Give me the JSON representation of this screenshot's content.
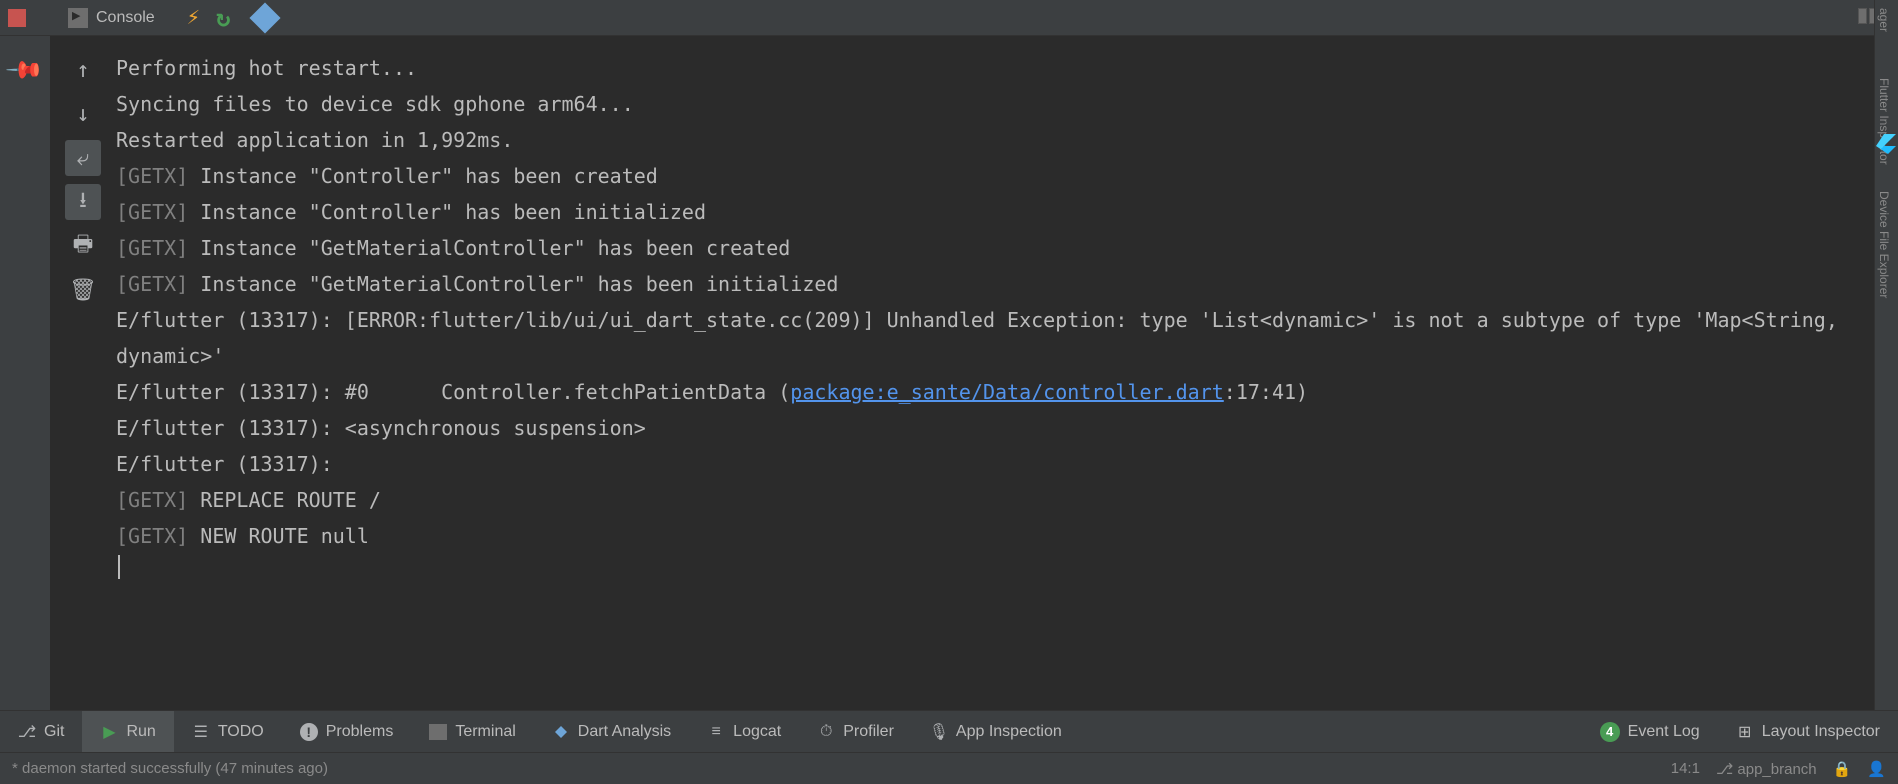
{
  "toolbar": {
    "console_label": "Console"
  },
  "console": {
    "lines": [
      {
        "type": "plain",
        "text": "Performing hot restart..."
      },
      {
        "type": "plain",
        "text": "Syncing files to device sdk gphone arm64..."
      },
      {
        "type": "plain",
        "text": "Restarted application in 1,992ms."
      },
      {
        "type": "tagged",
        "tag": "[GETX]",
        "text": " Instance \"Controller\" has been created"
      },
      {
        "type": "tagged",
        "tag": "[GETX]",
        "text": " Instance \"Controller\" has been initialized"
      },
      {
        "type": "tagged",
        "tag": "[GETX]",
        "text": " Instance \"GetMaterialController\" has been created"
      },
      {
        "type": "tagged",
        "tag": "[GETX]",
        "text": " Instance \"GetMaterialController\" has been initialized"
      },
      {
        "type": "plain",
        "text": "E/flutter (13317): [ERROR:flutter/lib/ui/ui_dart_state.cc(209)] Unhandled Exception: type 'List<dynamic>' is not a subtype of type 'Map<String, dynamic>'"
      },
      {
        "type": "link",
        "prefix": "E/flutter (13317): #0      Controller.fetchPatientData (",
        "link": "package:e_sante/Data/controller.dart",
        "suffix": ":17:41)"
      },
      {
        "type": "plain",
        "text": "E/flutter (13317): <asynchronous suspension>"
      },
      {
        "type": "plain",
        "text": "E/flutter (13317): "
      },
      {
        "type": "tagged",
        "tag": "[GETX]",
        "text": " REPLACE ROUTE /"
      },
      {
        "type": "tagged",
        "tag": "[GETX]",
        "text": " NEW ROUTE null"
      }
    ]
  },
  "bottom_tabs": {
    "git": "Git",
    "run": "Run",
    "todo": "TODO",
    "problems": "Problems",
    "terminal": "Terminal",
    "dart_analysis": "Dart Analysis",
    "logcat": "Logcat",
    "profiler": "Profiler",
    "app_inspection": "App Inspection",
    "event_log": "Event Log",
    "event_count": "4",
    "layout_inspector": "Layout Inspector"
  },
  "right_tabs": {
    "manager": "ager",
    "flutter_inspector": "Flutter Inspector",
    "device_file_explorer": "Device File Explorer"
  },
  "status": {
    "message": "* daemon started successfully (47 minutes ago)",
    "cursor": "14:1",
    "branch": "app_branch"
  }
}
